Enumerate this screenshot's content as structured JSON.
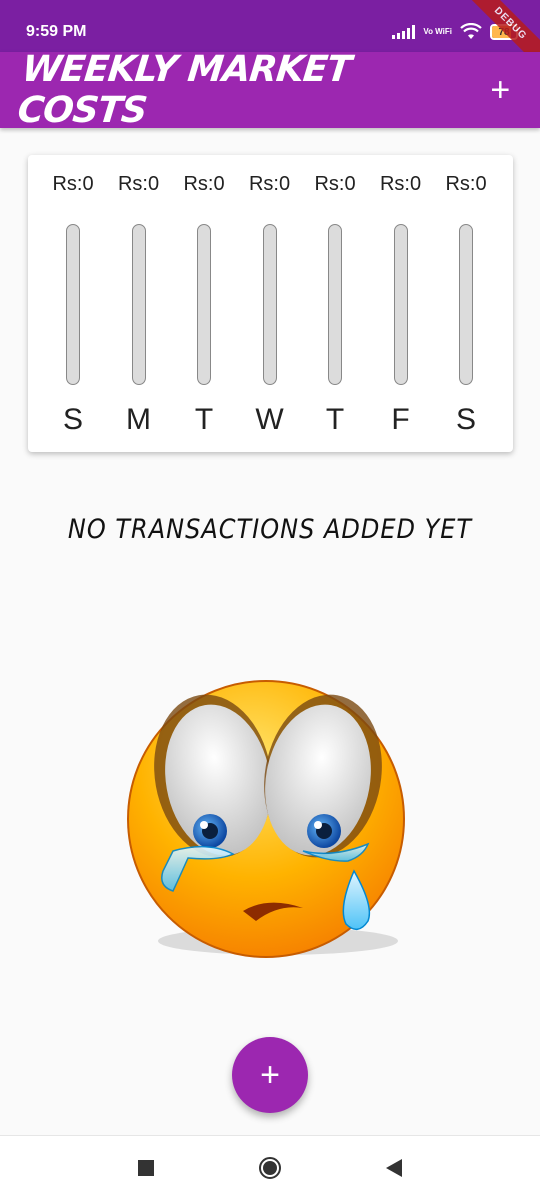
{
  "status_bar": {
    "time": "9:59 PM",
    "network_label": "Vo WiFi",
    "battery_level": "78",
    "debug_banner": "DEBUG"
  },
  "app_bar": {
    "title": "Weekly Market Costs",
    "add_action": "+"
  },
  "chart_data": {
    "type": "bar",
    "categories": [
      "S",
      "M",
      "T",
      "W",
      "T",
      "F",
      "S"
    ],
    "values": [
      0,
      0,
      0,
      0,
      0,
      0,
      0
    ],
    "value_labels": [
      "Rs:0",
      "Rs:0",
      "Rs:0",
      "Rs:0",
      "Rs:0",
      "Rs:0",
      "Rs:0"
    ],
    "title": "",
    "xlabel": "",
    "ylabel": "",
    "grid": false,
    "bar_fill_color": "#9c27b0",
    "bar_track_color": "#dcdcdc"
  },
  "empty_state": {
    "message": "No transactions added yet",
    "image_icon": "crying-emoji-icon"
  },
  "fab": {
    "label": "+"
  },
  "nav": {
    "recents_icon": "square-icon",
    "home_icon": "circle-icon",
    "back_icon": "triangle-back-icon"
  },
  "colors": {
    "primary": "#9c27b0",
    "status_bar": "#7b1fa2"
  }
}
